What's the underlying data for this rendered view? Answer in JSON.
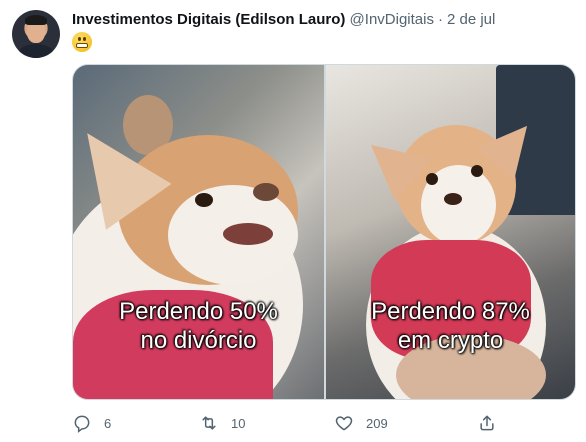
{
  "tweet": {
    "author_name": "Investimentos Digitais (Edilson Lauro)",
    "handle": "@InvDigitais",
    "separator": "·",
    "date": "2 de jul"
  },
  "media": {
    "left_caption_line1": "Perdendo 50%",
    "left_caption_line2": "no divórcio",
    "right_caption_line1": "Perdendo 87%",
    "right_caption_line2": "em crypto"
  },
  "actions": {
    "reply_count": "6",
    "retweet_count": "10",
    "like_count": "209"
  },
  "icons": {
    "reply": "reply-icon",
    "retweet": "retweet-icon",
    "like": "heart-icon",
    "share": "share-icon",
    "emoji": "grimacing-face-emoji"
  },
  "colors": {
    "text_primary": "#0f1419",
    "text_secondary": "#536471",
    "border": "#cfd9de"
  }
}
